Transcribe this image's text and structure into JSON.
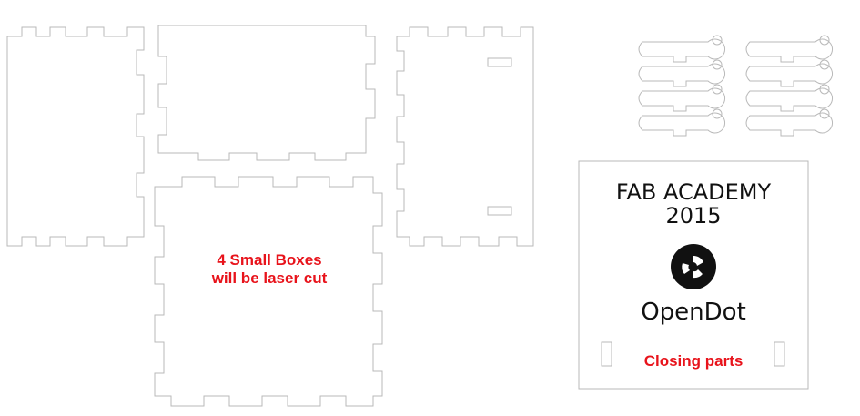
{
  "colors": {
    "outline": "#b9b9b9",
    "annotation": "#e8131b",
    "text": "#111111"
  },
  "annotation": {
    "line1": "4 Small Boxes",
    "line2": "will be laser cut"
  },
  "plate": {
    "title_line1": "FAB ACADEMY",
    "title_line2": "2015",
    "logo_icon": "opendot-logo-icon",
    "brand": "OpenDot",
    "caption": "Closing parts"
  }
}
